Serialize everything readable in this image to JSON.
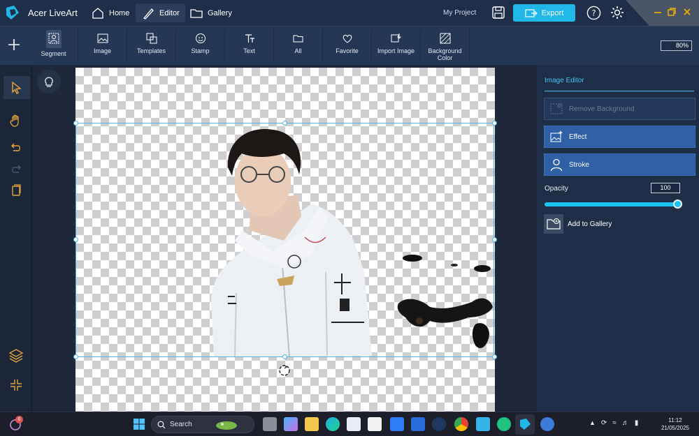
{
  "app": {
    "name": "Acer LiveArt",
    "project": "My Project",
    "export_label": "Export"
  },
  "nav": {
    "home": "Home",
    "editor": "Editor",
    "gallery": "Gallery"
  },
  "toolbar": {
    "tools": [
      "Segment",
      "Image",
      "Templates",
      "Stamp",
      "Text",
      "All",
      "Favorite",
      "Import Image",
      "Background Color"
    ],
    "zoom": "80%"
  },
  "panel": {
    "title": "Image Editor",
    "remove_bg": "Remove Background",
    "effect": "Effect",
    "stroke": "Stroke",
    "opacity_label": "Opacity",
    "opacity_value": "100",
    "opacity_fraction": 1.0,
    "add_gallery": "Add to Gallery"
  },
  "taskbar": {
    "search": "Search",
    "time": "11:12",
    "date": "21/05/2025",
    "badge": "6"
  },
  "colors": {
    "accent": "#1fb8e8",
    "panel_button": "#2f5fa4"
  }
}
